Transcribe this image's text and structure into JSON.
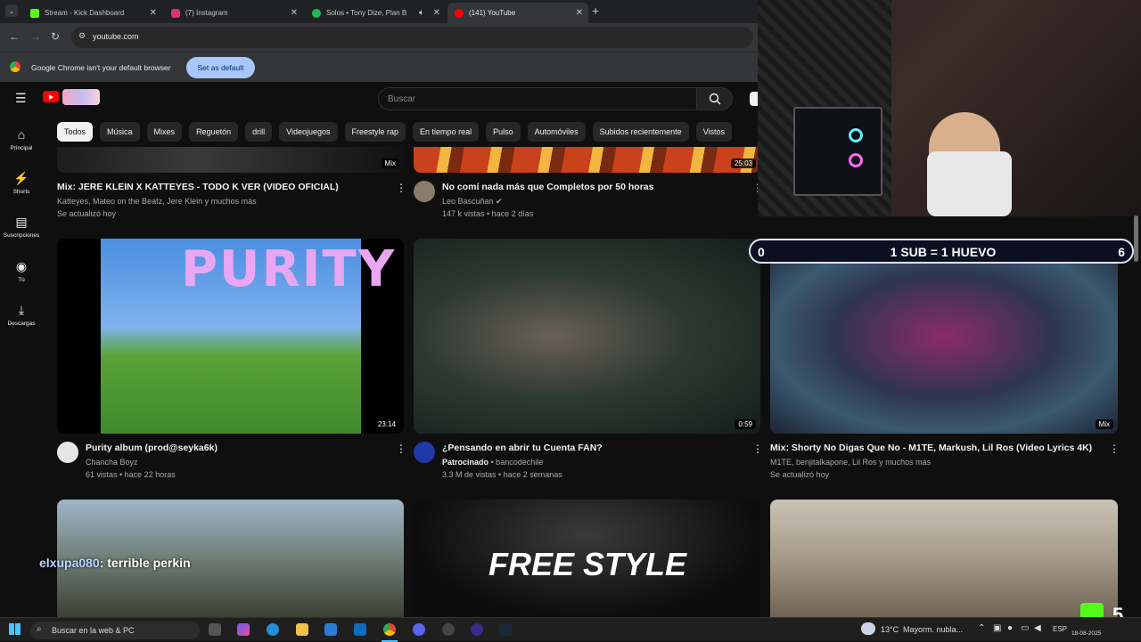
{
  "browser": {
    "tabs": [
      {
        "title": "Stream - Kick Dashboard",
        "color": "#53fc18"
      },
      {
        "title": "(7) Instagram",
        "color": "#e1306c"
      },
      {
        "title": "Solos • Tony Dize, Plan B",
        "color": "#1db954"
      },
      {
        "title": "(141) YouTube",
        "color": "#ff0000"
      }
    ],
    "url": "youtube.com",
    "banner_text": "Google Chrome isn't your default browser",
    "banner_button": "Set as default"
  },
  "youtube": {
    "search_placeholder": "Buscar",
    "sidebar": [
      {
        "icon": "⌂",
        "label": "Principal"
      },
      {
        "icon": "⚡",
        "label": "Shorts"
      },
      {
        "icon": "▤",
        "label": "Suscripciones"
      },
      {
        "icon": "◉",
        "label": "Tú"
      },
      {
        "icon": "⤓",
        "label": "Descargas"
      }
    ],
    "chips": [
      "Todos",
      "Música",
      "Mixes",
      "Reguetón",
      "drill",
      "Videojuegos",
      "Freestyle rap",
      "En tiempo real",
      "Pulso",
      "Automóviles",
      "Subidos recientemente",
      "Vistos"
    ],
    "videos": [
      {
        "title": "Mix: JERE KLEIN X KATTEYES - TODO K VER (VIDEO OFICIAL)",
        "line1": "Katteyes, Mateo on the Beatz, Jere Klein y muchos más",
        "line2": "Se actualizó hoy",
        "badge": "Mix"
      },
      {
        "title": "No comí nada más que Completos por 50 horas",
        "line1": "Leo Bascuñan ✔",
        "line2": "147 k vistas • hace 2 días",
        "badge": "25:03"
      },
      {
        "title": "Purity album (prod@seyka6k)",
        "line1": "Chancha Boyz",
        "line2": "61 vistas • hace 22 horas",
        "badge": "23:14"
      },
      {
        "title": "¿Pensando en abrir tu Cuenta FAN?",
        "line1_bold": "Patrocinado",
        "line1": "• bancodechile",
        "line2": "3.3 M de vistas • hace 2 semanas",
        "badge": "0:59"
      },
      {
        "title": "Mix: Shorty No Digas Que No - M1TE, Markush, Lil Ros (Video Lyrics 4K)",
        "line1": "M1TE, benjitalkapone, Lil Ros y muchos más",
        "line2": "Se actualizó hoy",
        "badge": "Mix"
      }
    ],
    "thumb_texts": {
      "purity": "PURITY",
      "freestyle": "FREE STYLE"
    }
  },
  "stream_overlay": {
    "goal_left": "0",
    "goal_text": "1 SUB = 1 HUEVO",
    "goal_right": "6",
    "chat_user": "elxupa080",
    "chat_message": ": terrible perkin",
    "kick_count": "5"
  },
  "taskbar": {
    "search": "Buscar en la web & PC",
    "weather": "13°C",
    "weather_text": "Mayorm. nubla...",
    "lang": "ESP",
    "date": "18-08-2025"
  }
}
